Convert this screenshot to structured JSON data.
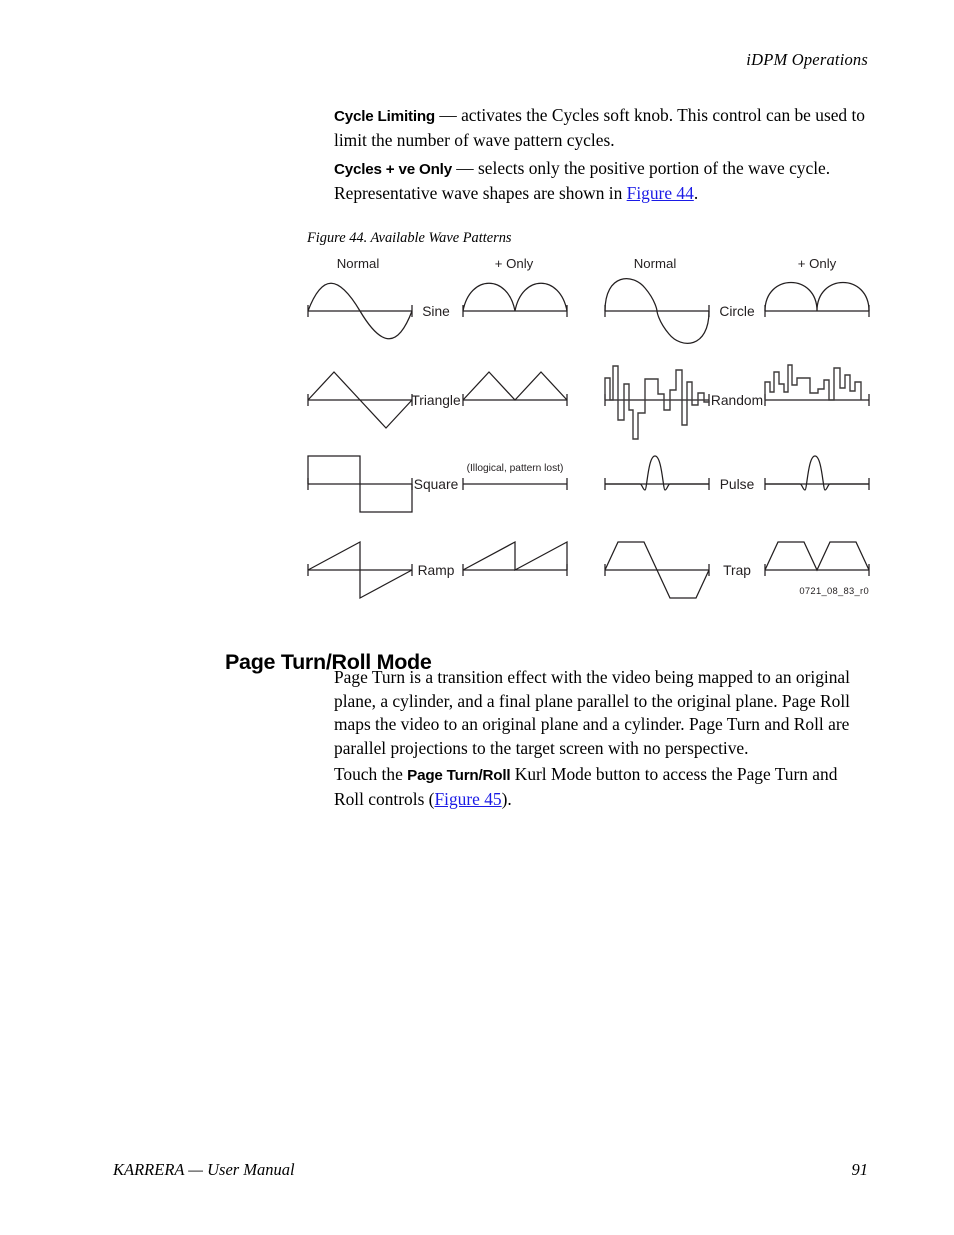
{
  "running_head": "iDPM Operations",
  "paragraphs": [
    {
      "id": "cycle-limiting",
      "term": "Cycle Limiting",
      "text_before_link": " — activates the Cycles soft knob. This control can be used to limit the number of wave pattern cycles.",
      "link": "",
      "text_after_link": ""
    },
    {
      "id": "cycles-pos-only",
      "term": "Cycles + ve Only",
      "text_before_link": " — selects only the positive portion of the wave cycle. Representative wave shapes are shown in ",
      "link": "Figure 44",
      "text_after_link": "."
    }
  ],
  "figure": {
    "caption": "Figure 44.  Available Wave Patterns",
    "id_stamp": "0721_08_83_r0",
    "column_headers": [
      "Normal",
      "+ Only",
      "Normal",
      "+ Only"
    ],
    "note_illogical": "(Illogical, pattern lost)",
    "left_rows": [
      {
        "label": "Sine",
        "normal": "sine-bipolar",
        "positive": "sine-rectified"
      },
      {
        "label": "Triangle",
        "normal": "triangle-bipolar",
        "positive": "triangle-rectified"
      },
      {
        "label": "Square",
        "normal": "square-bipolar",
        "positive": "flat-illogical"
      },
      {
        "label": "Ramp",
        "normal": "ramp-bipolar",
        "positive": "ramp-sawtooth"
      }
    ],
    "right_rows": [
      {
        "label": "Circle",
        "normal": "circle-bipolar",
        "positive": "circle-rectified"
      },
      {
        "label": "Random",
        "normal": "random-bipolar",
        "positive": "random-positive"
      },
      {
        "label": "Pulse",
        "normal": "pulse-single",
        "positive": "pulse-single"
      },
      {
        "label": "Trap",
        "normal": "trap-bipolar",
        "positive": "trap-rectified"
      }
    ]
  },
  "section": {
    "heading": "Page Turn/Roll Mode",
    "body_paragraph": "Page Turn is a transition effect with the video being mapped to an original plane, a cylinder, and a final plane parallel to the original plane. Page Roll maps the video to an original plane and a cylinder. Page Turn and Roll are parallel projections to the target screen with no perspective.",
    "touch_prefix": "Touch the ",
    "touch_bold": "Page Turn/Roll",
    "touch_middle": " Kurl Mode button to access the Page Turn and Roll controls (",
    "touch_link": "Figure 45",
    "touch_suffix": ")."
  },
  "footer": {
    "left": "KARRERA  —  User Manual",
    "page": "91"
  },
  "colors": {
    "link": "#1a1ae6",
    "ink": "#231f20",
    "random_stroke": "#3f3b3c"
  }
}
